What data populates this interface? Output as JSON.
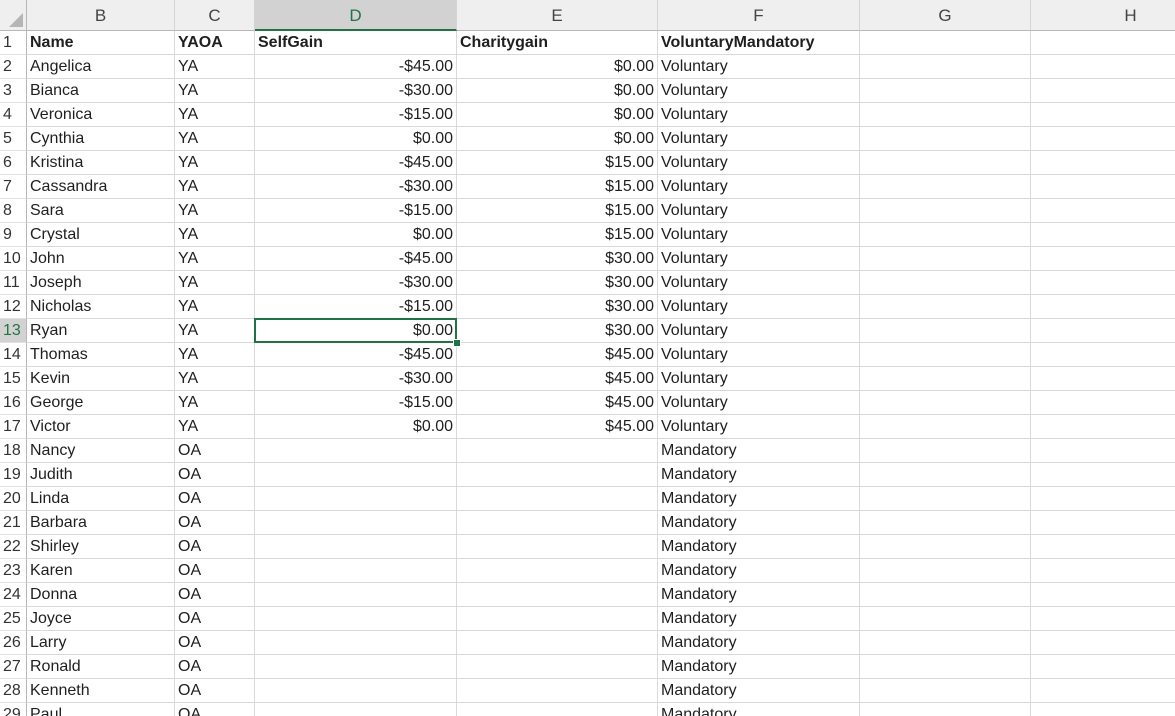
{
  "columns": [
    {
      "letter": "B",
      "active": false
    },
    {
      "letter": "C",
      "active": false
    },
    {
      "letter": "D",
      "active": true
    },
    {
      "letter": "E",
      "active": false
    },
    {
      "letter": "F",
      "active": false
    },
    {
      "letter": "G",
      "active": false
    },
    {
      "letter": "H",
      "active": false
    }
  ],
  "active_cell": {
    "row": "13",
    "column": "D"
  },
  "colors": {
    "accent": "#217346",
    "header_bg": "#efefef",
    "grid": "#d9d9d9"
  },
  "rows": [
    {
      "n": "1",
      "cells": [
        "Name",
        "YAOA",
        "SelfGain",
        "Charitygain",
        "VoluntaryMandatory",
        "",
        ""
      ],
      "header": true
    },
    {
      "n": "2",
      "cells": [
        "Angelica",
        "YA",
        "-$45.00",
        "$0.00",
        "Voluntary",
        "",
        ""
      ]
    },
    {
      "n": "3",
      "cells": [
        "Bianca",
        "YA",
        "-$30.00",
        "$0.00",
        "Voluntary",
        "",
        ""
      ]
    },
    {
      "n": "4",
      "cells": [
        "Veronica",
        "YA",
        "-$15.00",
        "$0.00",
        "Voluntary",
        "",
        ""
      ]
    },
    {
      "n": "5",
      "cells": [
        "Cynthia",
        "YA",
        "$0.00",
        "$0.00",
        "Voluntary",
        "",
        ""
      ]
    },
    {
      "n": "6",
      "cells": [
        "Kristina",
        "YA",
        "-$45.00",
        "$15.00",
        "Voluntary",
        "",
        ""
      ]
    },
    {
      "n": "7",
      "cells": [
        "Cassandra",
        "YA",
        "-$30.00",
        "$15.00",
        "Voluntary",
        "",
        ""
      ]
    },
    {
      "n": "8",
      "cells": [
        "Sara",
        "YA",
        "-$15.00",
        "$15.00",
        "Voluntary",
        "",
        ""
      ]
    },
    {
      "n": "9",
      "cells": [
        "Crystal",
        "YA",
        "$0.00",
        "$15.00",
        "Voluntary",
        "",
        ""
      ]
    },
    {
      "n": "10",
      "cells": [
        "John",
        "YA",
        "-$45.00",
        "$30.00",
        "Voluntary",
        "",
        ""
      ]
    },
    {
      "n": "11",
      "cells": [
        "Joseph",
        "YA",
        "-$30.00",
        "$30.00",
        "Voluntary",
        "",
        ""
      ]
    },
    {
      "n": "12",
      "cells": [
        "Nicholas",
        "YA",
        "-$15.00",
        "$30.00",
        "Voluntary",
        "",
        ""
      ]
    },
    {
      "n": "13",
      "cells": [
        "Ryan",
        "YA",
        "$0.00",
        "$30.00",
        "Voluntary",
        "",
        ""
      ]
    },
    {
      "n": "14",
      "cells": [
        "Thomas",
        "YA",
        "-$45.00",
        "$45.00",
        "Voluntary",
        "",
        ""
      ]
    },
    {
      "n": "15",
      "cells": [
        "Kevin",
        "YA",
        "-$30.00",
        "$45.00",
        "Voluntary",
        "",
        ""
      ]
    },
    {
      "n": "16",
      "cells": [
        "George",
        "YA",
        "-$15.00",
        "$45.00",
        "Voluntary",
        "",
        ""
      ]
    },
    {
      "n": "17",
      "cells": [
        "Victor",
        "YA",
        "$0.00",
        "$45.00",
        "Voluntary",
        "",
        ""
      ]
    },
    {
      "n": "18",
      "cells": [
        "Nancy",
        "OA",
        "",
        "",
        "Mandatory",
        "",
        ""
      ]
    },
    {
      "n": "19",
      "cells": [
        "Judith",
        "OA",
        "",
        "",
        "Mandatory",
        "",
        ""
      ]
    },
    {
      "n": "20",
      "cells": [
        "Linda",
        "OA",
        "",
        "",
        "Mandatory",
        "",
        ""
      ]
    },
    {
      "n": "21",
      "cells": [
        "Barbara",
        "OA",
        "",
        "",
        "Mandatory",
        "",
        ""
      ]
    },
    {
      "n": "22",
      "cells": [
        "Shirley",
        "OA",
        "",
        "",
        "Mandatory",
        "",
        ""
      ]
    },
    {
      "n": "23",
      "cells": [
        "Karen",
        "OA",
        "",
        "",
        "Mandatory",
        "",
        ""
      ]
    },
    {
      "n": "24",
      "cells": [
        "Donna",
        "OA",
        "",
        "",
        "Mandatory",
        "",
        ""
      ]
    },
    {
      "n": "25",
      "cells": [
        "Joyce",
        "OA",
        "",
        "",
        "Mandatory",
        "",
        ""
      ]
    },
    {
      "n": "26",
      "cells": [
        "Larry",
        "OA",
        "",
        "",
        "Mandatory",
        "",
        ""
      ]
    },
    {
      "n": "27",
      "cells": [
        "Ronald",
        "OA",
        "",
        "",
        "Mandatory",
        "",
        ""
      ]
    },
    {
      "n": "28",
      "cells": [
        "Kenneth",
        "OA",
        "",
        "",
        "Mandatory",
        "",
        ""
      ]
    },
    {
      "n": "29",
      "cells": [
        "Paul",
        "OA",
        "",
        "",
        "Mandatory",
        "",
        ""
      ]
    }
  ]
}
